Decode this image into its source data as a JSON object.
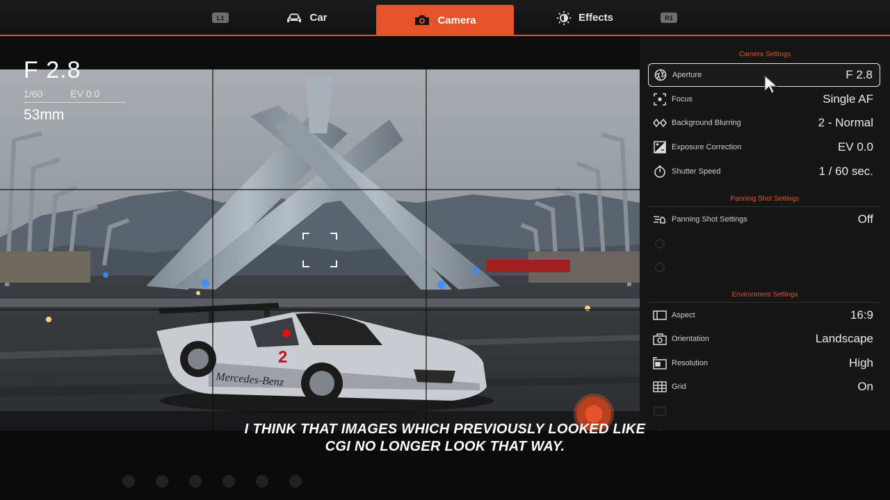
{
  "tabs": {
    "left_shoulder": "L1",
    "right_shoulder": "R1",
    "items": [
      {
        "label": "Car",
        "icon": "car-icon"
      },
      {
        "label": "Camera",
        "icon": "camera-icon",
        "active": true
      },
      {
        "label": "Effects",
        "icon": "brightness-icon"
      }
    ]
  },
  "hud": {
    "aperture": "F 2.8",
    "shutter": "1/60",
    "ev": "EV 0.0",
    "focal_length": "53mm"
  },
  "panel": {
    "camera_section": {
      "title": "Camera Settings",
      "rows": [
        {
          "label": "Aperture",
          "value": "F 2.8",
          "icon": "aperture-icon"
        },
        {
          "label": "Focus",
          "value": "Single AF",
          "icon": "focus-icon"
        },
        {
          "label": "Background Blurring",
          "value": "2 - Normal",
          "icon": "blur-icon"
        },
        {
          "label": "Exposure Correction",
          "value": "EV 0.0",
          "icon": "exposure-icon"
        },
        {
          "label": "Shutter Speed",
          "value": "1 / 60 sec.",
          "icon": "timer-icon"
        }
      ]
    },
    "panning_section": {
      "title": "Panning Shot Settings",
      "rows": [
        {
          "label": "Panning Shot Settings",
          "value": "Off",
          "icon": "panning-icon"
        }
      ]
    },
    "environment_section": {
      "title": "Environment Settings",
      "rows": [
        {
          "label": "Aspect",
          "value": "16:9",
          "icon": "aspect-icon"
        },
        {
          "label": "Orientation",
          "value": "Landscape",
          "icon": "orientation-icon"
        },
        {
          "label": "Resolution",
          "value": "High",
          "icon": "resolution-icon"
        },
        {
          "label": "Grid",
          "value": "On",
          "icon": "grid-icon"
        }
      ]
    }
  },
  "subtitle": {
    "line1": "I THINK THAT IMAGES WHICH PREVIOUSLY LOOKED LIKE",
    "line2": "CGI NO LONGER LOOK THAT WAY."
  },
  "colors": {
    "accent": "#e4532a",
    "panel_bg": "#161616",
    "sky": "#9da2a7"
  }
}
